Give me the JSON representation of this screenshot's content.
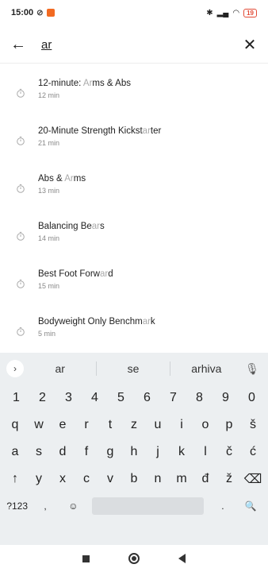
{
  "status": {
    "time": "15:00",
    "battery": "19"
  },
  "search": {
    "query": "ar"
  },
  "results": [
    {
      "pre": "12-minute: ",
      "hl": "Ar",
      "post": "ms & Abs",
      "duration": "12 min"
    },
    {
      "pre": "20-Minute Strength Kickst",
      "hl": "ar",
      "post": "ter",
      "duration": "21 min"
    },
    {
      "pre": "Abs & ",
      "hl": "Ar",
      "post": "ms",
      "duration": "13 min"
    },
    {
      "pre": "Balancing Be",
      "hl": "ar",
      "post": "s",
      "duration": "14 min"
    },
    {
      "pre": "Best Foot Forw",
      "hl": "ar",
      "post": "d",
      "duration": "15 min"
    },
    {
      "pre": "Bodyweight Only Benchm",
      "hl": "ar",
      "post": "k",
      "duration": "5 min"
    }
  ],
  "keyboard": {
    "suggestions": [
      "ar",
      "se",
      "arhiva"
    ],
    "row1": [
      "1",
      "2",
      "3",
      "4",
      "5",
      "6",
      "7",
      "8",
      "9",
      "0"
    ],
    "row2": [
      "q",
      "w",
      "e",
      "r",
      "t",
      "z",
      "u",
      "i",
      "o",
      "p",
      "š"
    ],
    "row3": [
      "a",
      "s",
      "d",
      "f",
      "g",
      "h",
      "j",
      "k",
      "l",
      "č",
      "ć"
    ],
    "row4": [
      "↑",
      "y",
      "x",
      "c",
      "v",
      "b",
      "n",
      "m",
      "đ",
      "ž",
      "⌫"
    ],
    "bottom": {
      "symbols": "?123",
      "comma": ",",
      "emoji": "☺",
      "period": ".",
      "search": "🔍"
    }
  },
  "icons": {
    "back": "arrow-left-icon",
    "close": "close-icon",
    "timer": "stopwatch-icon"
  }
}
